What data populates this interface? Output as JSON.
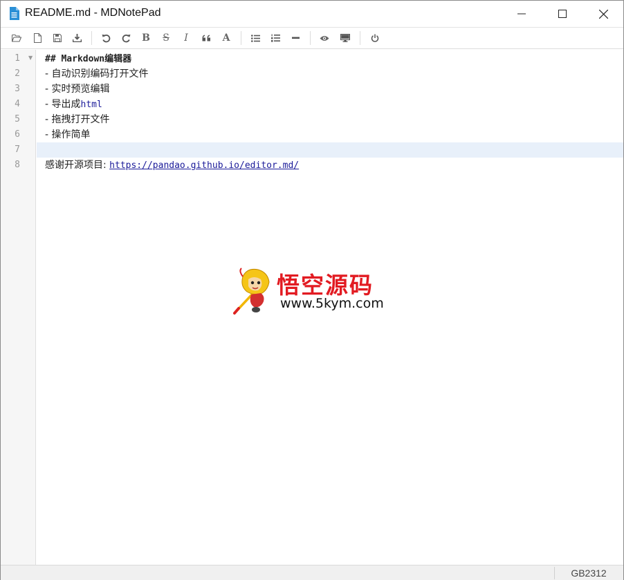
{
  "window": {
    "title": "README.md - MDNotePad",
    "controls": [
      "minimize",
      "maximize",
      "close"
    ]
  },
  "toolbar": {
    "buttons": [
      {
        "name": "open-file",
        "icon": "folder-open-icon"
      },
      {
        "name": "new-file",
        "icon": "file-icon"
      },
      {
        "name": "save",
        "icon": "floppy-icon"
      },
      {
        "name": "export",
        "icon": "download-icon"
      },
      {
        "name": "undo",
        "icon": "undo-icon"
      },
      {
        "name": "redo",
        "icon": "redo-icon"
      },
      {
        "name": "bold",
        "icon": "bold-icon",
        "glyph": "B"
      },
      {
        "name": "strikethrough",
        "icon": "strikethrough-icon",
        "glyph": "S"
      },
      {
        "name": "italic",
        "icon": "italic-icon",
        "glyph": "I"
      },
      {
        "name": "quote",
        "icon": "quote-icon"
      },
      {
        "name": "uppercase",
        "icon": "font-icon",
        "glyph": "A"
      },
      {
        "name": "unordered-list",
        "icon": "list-ul-icon"
      },
      {
        "name": "ordered-list",
        "icon": "list-ol-icon"
      },
      {
        "name": "horizontal-rule",
        "icon": "minus-icon"
      },
      {
        "name": "preview",
        "icon": "eye-icon"
      },
      {
        "name": "fullscreen",
        "icon": "desktop-icon"
      },
      {
        "name": "exit",
        "icon": "power-icon"
      }
    ]
  },
  "editor": {
    "line_numbers": [
      "1",
      "2",
      "3",
      "4",
      "5",
      "6",
      "7",
      "8"
    ],
    "active_line": 7,
    "lines": {
      "l1": "## Markdown编辑器",
      "l2": "- 自动识别编码打开文件",
      "l3": "- 实时预览编辑",
      "l4_text": "- 导出成",
      "l4_code": "html",
      "l5": "- 拖拽打开文件",
      "l6": "- 操作简单",
      "l7": "",
      "l8_text": "感谢开源项目: ",
      "l8_link": "https://pandao.github.io/editor.md/"
    }
  },
  "watermark": {
    "title": "悟空源码",
    "url": "www.5kym.com"
  },
  "status": {
    "encoding": "GB2312"
  },
  "colors": {
    "link": "#1a1a99",
    "active_line": "#e8f0fa",
    "watermark_red": "#e21b22",
    "app_icon": "#2a8fd6"
  }
}
